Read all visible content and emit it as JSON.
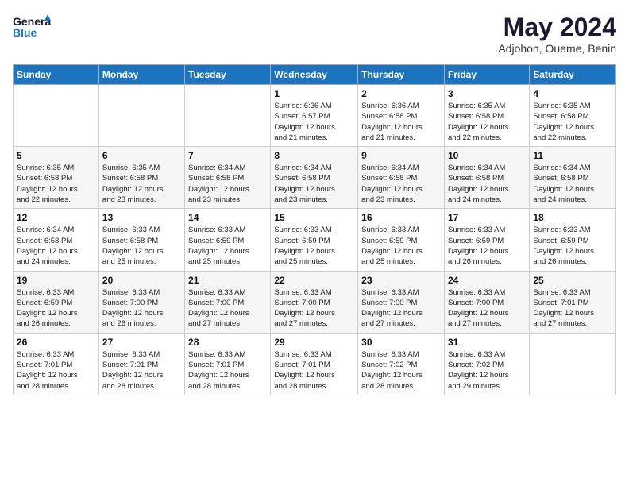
{
  "logo": {
    "text_general": "General",
    "text_blue": "Blue"
  },
  "header": {
    "month_year": "May 2024",
    "location": "Adjohon, Oueme, Benin"
  },
  "days_of_week": [
    "Sunday",
    "Monday",
    "Tuesday",
    "Wednesday",
    "Thursday",
    "Friday",
    "Saturday"
  ],
  "weeks": [
    [
      {
        "day": "",
        "info": ""
      },
      {
        "day": "",
        "info": ""
      },
      {
        "day": "",
        "info": ""
      },
      {
        "day": "1",
        "info": "Sunrise: 6:36 AM\nSunset: 6:57 PM\nDaylight: 12 hours\nand 21 minutes."
      },
      {
        "day": "2",
        "info": "Sunrise: 6:36 AM\nSunset: 6:58 PM\nDaylight: 12 hours\nand 21 minutes."
      },
      {
        "day": "3",
        "info": "Sunrise: 6:35 AM\nSunset: 6:58 PM\nDaylight: 12 hours\nand 22 minutes."
      },
      {
        "day": "4",
        "info": "Sunrise: 6:35 AM\nSunset: 6:58 PM\nDaylight: 12 hours\nand 22 minutes."
      }
    ],
    [
      {
        "day": "5",
        "info": "Sunrise: 6:35 AM\nSunset: 6:58 PM\nDaylight: 12 hours\nand 22 minutes."
      },
      {
        "day": "6",
        "info": "Sunrise: 6:35 AM\nSunset: 6:58 PM\nDaylight: 12 hours\nand 23 minutes."
      },
      {
        "day": "7",
        "info": "Sunrise: 6:34 AM\nSunset: 6:58 PM\nDaylight: 12 hours\nand 23 minutes."
      },
      {
        "day": "8",
        "info": "Sunrise: 6:34 AM\nSunset: 6:58 PM\nDaylight: 12 hours\nand 23 minutes."
      },
      {
        "day": "9",
        "info": "Sunrise: 6:34 AM\nSunset: 6:58 PM\nDaylight: 12 hours\nand 23 minutes."
      },
      {
        "day": "10",
        "info": "Sunrise: 6:34 AM\nSunset: 6:58 PM\nDaylight: 12 hours\nand 24 minutes."
      },
      {
        "day": "11",
        "info": "Sunrise: 6:34 AM\nSunset: 6:58 PM\nDaylight: 12 hours\nand 24 minutes."
      }
    ],
    [
      {
        "day": "12",
        "info": "Sunrise: 6:34 AM\nSunset: 6:58 PM\nDaylight: 12 hours\nand 24 minutes."
      },
      {
        "day": "13",
        "info": "Sunrise: 6:33 AM\nSunset: 6:58 PM\nDaylight: 12 hours\nand 25 minutes."
      },
      {
        "day": "14",
        "info": "Sunrise: 6:33 AM\nSunset: 6:59 PM\nDaylight: 12 hours\nand 25 minutes."
      },
      {
        "day": "15",
        "info": "Sunrise: 6:33 AM\nSunset: 6:59 PM\nDaylight: 12 hours\nand 25 minutes."
      },
      {
        "day": "16",
        "info": "Sunrise: 6:33 AM\nSunset: 6:59 PM\nDaylight: 12 hours\nand 25 minutes."
      },
      {
        "day": "17",
        "info": "Sunrise: 6:33 AM\nSunset: 6:59 PM\nDaylight: 12 hours\nand 26 minutes."
      },
      {
        "day": "18",
        "info": "Sunrise: 6:33 AM\nSunset: 6:59 PM\nDaylight: 12 hours\nand 26 minutes."
      }
    ],
    [
      {
        "day": "19",
        "info": "Sunrise: 6:33 AM\nSunset: 6:59 PM\nDaylight: 12 hours\nand 26 minutes."
      },
      {
        "day": "20",
        "info": "Sunrise: 6:33 AM\nSunset: 7:00 PM\nDaylight: 12 hours\nand 26 minutes."
      },
      {
        "day": "21",
        "info": "Sunrise: 6:33 AM\nSunset: 7:00 PM\nDaylight: 12 hours\nand 27 minutes."
      },
      {
        "day": "22",
        "info": "Sunrise: 6:33 AM\nSunset: 7:00 PM\nDaylight: 12 hours\nand 27 minutes."
      },
      {
        "day": "23",
        "info": "Sunrise: 6:33 AM\nSunset: 7:00 PM\nDaylight: 12 hours\nand 27 minutes."
      },
      {
        "day": "24",
        "info": "Sunrise: 6:33 AM\nSunset: 7:00 PM\nDaylight: 12 hours\nand 27 minutes."
      },
      {
        "day": "25",
        "info": "Sunrise: 6:33 AM\nSunset: 7:01 PM\nDaylight: 12 hours\nand 27 minutes."
      }
    ],
    [
      {
        "day": "26",
        "info": "Sunrise: 6:33 AM\nSunset: 7:01 PM\nDaylight: 12 hours\nand 28 minutes."
      },
      {
        "day": "27",
        "info": "Sunrise: 6:33 AM\nSunset: 7:01 PM\nDaylight: 12 hours\nand 28 minutes."
      },
      {
        "day": "28",
        "info": "Sunrise: 6:33 AM\nSunset: 7:01 PM\nDaylight: 12 hours\nand 28 minutes."
      },
      {
        "day": "29",
        "info": "Sunrise: 6:33 AM\nSunset: 7:01 PM\nDaylight: 12 hours\nand 28 minutes."
      },
      {
        "day": "30",
        "info": "Sunrise: 6:33 AM\nSunset: 7:02 PM\nDaylight: 12 hours\nand 28 minutes."
      },
      {
        "day": "31",
        "info": "Sunrise: 6:33 AM\nSunset: 7:02 PM\nDaylight: 12 hours\nand 29 minutes."
      },
      {
        "day": "",
        "info": ""
      }
    ]
  ]
}
